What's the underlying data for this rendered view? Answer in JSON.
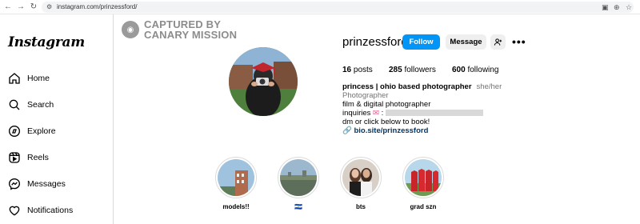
{
  "browser": {
    "url": "instagram.com/prinzessford/"
  },
  "sidebar": {
    "logo": "Instagram",
    "items": [
      {
        "label": "Home",
        "icon": "home-icon"
      },
      {
        "label": "Search",
        "icon": "search-icon"
      },
      {
        "label": "Explore",
        "icon": "compass-icon"
      },
      {
        "label": "Reels",
        "icon": "reels-icon"
      },
      {
        "label": "Messages",
        "icon": "messenger-icon"
      },
      {
        "label": "Notifications",
        "icon": "heart-icon"
      }
    ]
  },
  "watermark": {
    "line1": "CAPTURED BY",
    "line2": "CANARY MISSION"
  },
  "profile": {
    "username": "prinzessford",
    "follow_label": "Follow",
    "message_label": "Message",
    "posts_count": "16",
    "posts_label": "posts",
    "followers_count": "285",
    "followers_label": "followers",
    "following_count": "600",
    "following_label": "following",
    "name": "princess | ohio based photographer",
    "pronouns": "she/her",
    "category": "Photographer",
    "bio_line1": "film & digital photographer",
    "bio_inquiries": "inquiries",
    "bio_line3": "dm or click below to book!",
    "link": "bio.site/prinzessford"
  },
  "highlights": [
    {
      "label": "models!!"
    },
    {
      "label": "🇸🇻"
    },
    {
      "label": "bts"
    },
    {
      "label": "grad szn"
    }
  ],
  "colors": {
    "follow_button": "#0095f6",
    "secondary_button": "#efefef",
    "link": "#00376b"
  }
}
